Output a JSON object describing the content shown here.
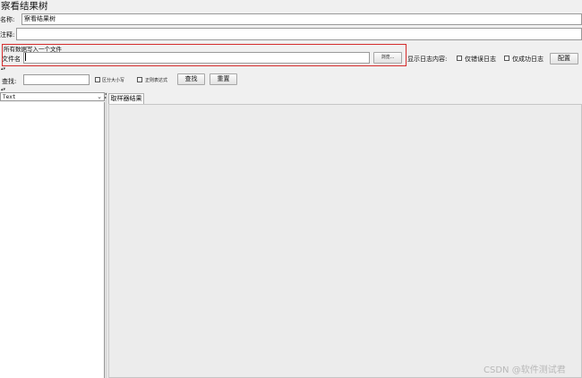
{
  "window": {
    "title": "察看结果树"
  },
  "name_field": {
    "label": "名称:",
    "value": "察看结果树"
  },
  "comment_field": {
    "label": "注释:",
    "value": ""
  },
  "file_section": {
    "heading": "所有数据写入一个文件",
    "filename_label": "文件名",
    "filename_value": "",
    "browse_label": "浏览...",
    "log_display_label": "显示日志内容:",
    "errors_only_label": "仅错误日志",
    "success_only_label": "仅成功日志",
    "configure_label": "配置"
  },
  "search": {
    "label": "查找:",
    "value": "",
    "case_sensitive_label": "区分大小写",
    "regex_label": "正则表达式",
    "find_label": "查找",
    "reset_label": "重置"
  },
  "renderer": {
    "selected": "Text"
  },
  "tabs": [
    {
      "label": "取样器结果"
    }
  ],
  "watermark": "CSDN @软件测试君"
}
